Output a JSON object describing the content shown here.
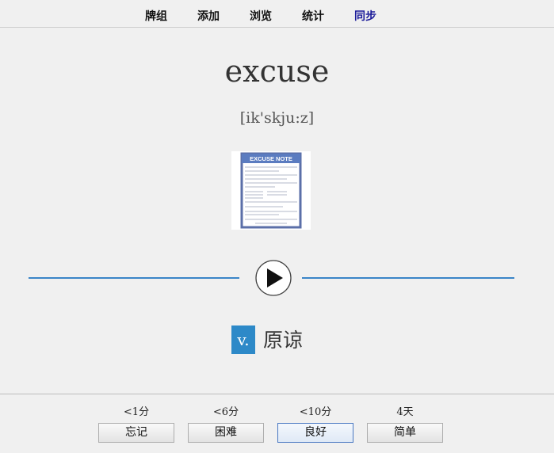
{
  "nav": {
    "tabs": [
      "牌组",
      "添加",
      "浏览",
      "统计",
      "同步"
    ]
  },
  "card": {
    "word": "excuse",
    "phonetic": "[ik'skju:z]",
    "image_caption": "EXCUSE NOTE",
    "part_of_speech": "v.",
    "meaning": "原谅"
  },
  "answer": {
    "intervals": [
      "<1分",
      "<6分",
      "<10分",
      "4天"
    ],
    "buttons": [
      "忘记",
      "困难",
      "良好",
      "简单"
    ]
  },
  "colors": {
    "accent": "#2d89c8",
    "sync_tab": "#1a1a99"
  }
}
